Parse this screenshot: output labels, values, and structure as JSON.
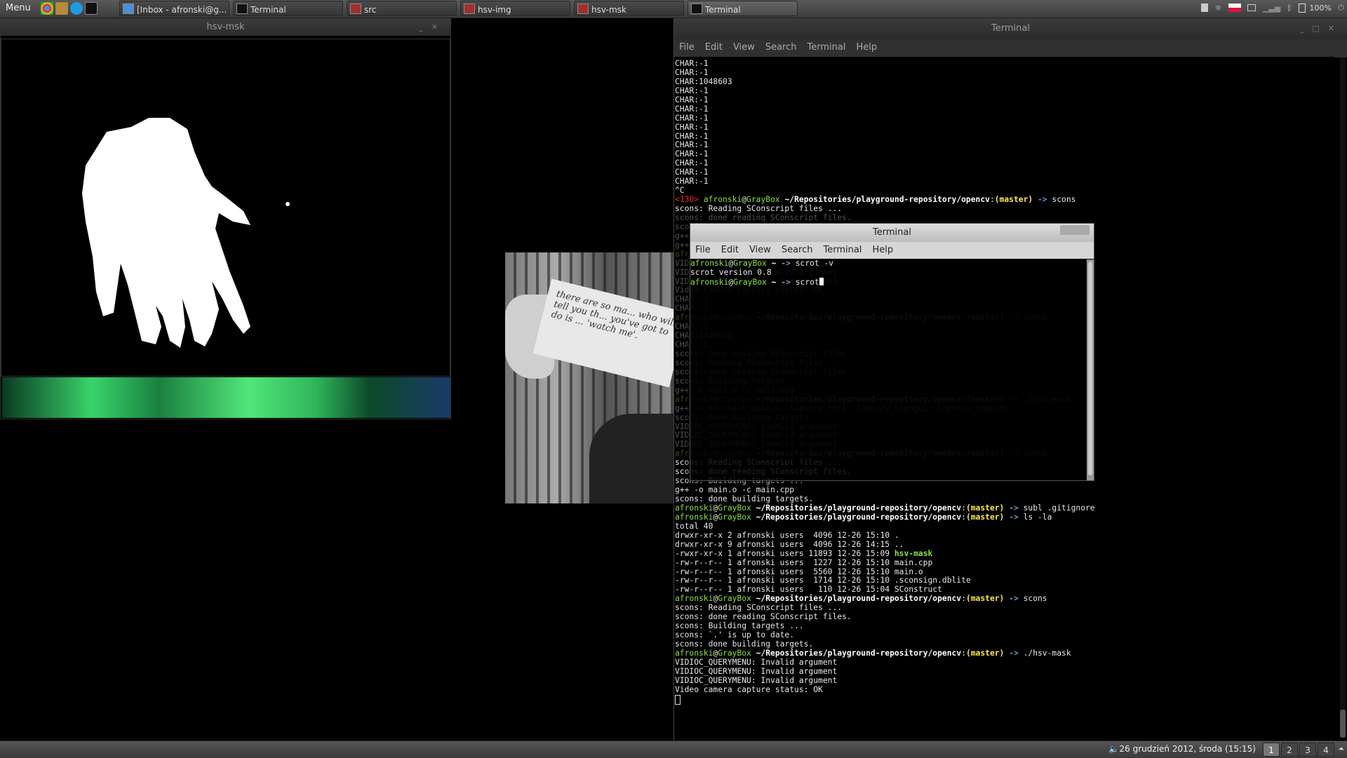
{
  "top_panel": {
    "menu_label": "Menu",
    "tasks": [
      {
        "label": "[Inbox - afronski@g...",
        "icon": "chrome-icon",
        "active": false
      },
      {
        "label": "Terminal",
        "icon": "terminal-icon",
        "active": false
      },
      {
        "label": "src",
        "icon": "folder-icon",
        "active": false
      },
      {
        "label": "hsv-img",
        "icon": "app-window-icon",
        "active": false
      },
      {
        "label": "hsv-msk",
        "icon": "app-window-icon",
        "active": false
      },
      {
        "label": "Terminal",
        "icon": "terminal-icon",
        "active": true
      }
    ],
    "battery": "100%"
  },
  "hsv_msk_window": {
    "title": "hsv-msk"
  },
  "terminal_main": {
    "title": "Terminal",
    "menu": [
      "File",
      "Edit",
      "View",
      "Search",
      "Terminal",
      "Help"
    ],
    "lines_top": [
      "CHAR:-1",
      "CHAR:-1",
      "CHAR:1048603",
      "CHAR:-1",
      "CHAR:-1",
      "CHAR:-1",
      "CHAR:-1",
      "CHAR:-1",
      "CHAR:-1",
      "CHAR:-1",
      "CHAR:-1",
      "CHAR:-1",
      "CHAR:-1",
      "CHAR:-1",
      "^C"
    ],
    "prompt_user": "afronski",
    "prompt_host": "GrayBox",
    "prompt_path": "~/Repositories/playground-repository/opencv",
    "prompt_branch": "(master)",
    "prompt_arrow": "->",
    "exit_code": "<130>",
    "cmd_scons": "scons",
    "hidden_lines": [
      "scons: Reading SConscript files ...",
      "scons: done reading SConscript files.",
      "g++ -o main.o -c main.cpp",
      "g++ -o hsv-mask main.o -lopencv_core -lopencv_highgui -lopencv_imgproc",
      "scons: done building targets.",
      "VIDIOC_QUERYMENU: Invalid argument",
      "VIDIOC_QUERYMENU: Invalid argument",
      "VIDIOC_QUERYMENU: Invalid argument",
      "Video camera capture status: OK",
      "CHAR:-1",
      "CHAR:1048603",
      "scons: Building targets ..."
    ],
    "lines_bottom_a": [
      "scons: Reading SConscript files ...",
      "scons: done reading SConscript files.",
      "scons: Building targets ...",
      "g++ -o main.o -c main.cpp",
      "scons: done building targets."
    ],
    "cmd_subl": "subl .gitignore",
    "cmd_ls": "ls -la",
    "ls_total": "total 40",
    "ls_rows": [
      {
        "perm": "drwxr-xr-x 2 afronski users  4096 12-26 15:10 ",
        "name": ".",
        "exec": false
      },
      {
        "perm": "drwxr-xr-x 9 afronski users  4096 12-26 14:15 ",
        "name": "..",
        "exec": false
      },
      {
        "perm": "-rwxr-xr-x 1 afronski users 11893 12-26 15:09 ",
        "name": "hsv-mask",
        "exec": true
      },
      {
        "perm": "-rw-r--r-- 1 afronski users  1227 12-26 15:10 ",
        "name": "main.cpp",
        "exec": false
      },
      {
        "perm": "-rw-r--r-- 1 afronski users  5560 12-26 15:10 ",
        "name": "main.o",
        "exec": false
      },
      {
        "perm": "-rw-r--r-- 1 afronski users  1714 12-26 15:10 ",
        "name": ".sconsign.dblite",
        "exec": false
      },
      {
        "perm": "-rw-r--r-- 1 afronski users   110 12-26 15:04 ",
        "name": "SConstruct",
        "exec": false
      }
    ],
    "lines_bottom_b": [
      "scons: Reading SConscript files ...",
      "scons: done reading SConscript files.",
      "scons: Building targets ...",
      "scons: `.' is up to date.",
      "scons: done building targets."
    ],
    "cmd_run": "./hsv-mask",
    "lines_bottom_c": [
      "VIDIOC_QUERYMENU: Invalid argument",
      "VIDIOC_QUERYMENU: Invalid argument",
      "VIDIOC_QUERYMENU: Invalid argument",
      "Video camera capture status: OK"
    ]
  },
  "terminal_small": {
    "title": "Terminal",
    "menu": [
      "File",
      "Edit",
      "View",
      "Search",
      "Terminal",
      "Help"
    ],
    "prompt_home": "~",
    "cmd1": "scrot -v",
    "out1": "scrot version 0.8",
    "cmd2": "scrot"
  },
  "photo": {
    "note_text": "there are so ma... who will tell you th... you've got to do is ... 'watch me'."
  },
  "bottom_panel": {
    "clock": "26 grudzień 2012, środa (15:15)",
    "workspaces": [
      "1",
      "2",
      "3",
      "4"
    ],
    "active_workspace": "1"
  }
}
